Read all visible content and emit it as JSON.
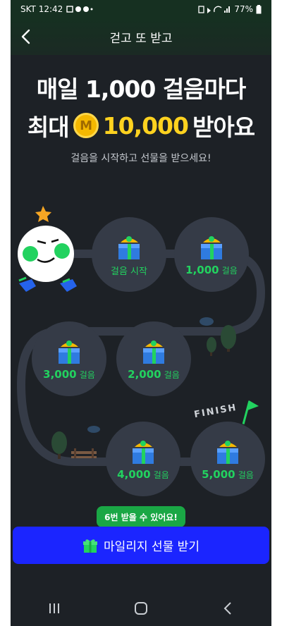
{
  "status": {
    "carrier_time": "SKT 12:42",
    "battery": "77%"
  },
  "header": {
    "title": "걷고 또 받고"
  },
  "hero": {
    "line1": "매일 1,000 걸음마다",
    "line2_prefix": "최대",
    "coin_letter": "M",
    "line2_amount": "10,000",
    "line2_suffix": "받아요"
  },
  "subtitle": "걸음을 시작하고 선물을 받으세요!",
  "milestones": [
    {
      "label": "걸음 시작"
    },
    {
      "num": "1,000",
      "unit": "걸음"
    },
    {
      "num": "2,000",
      "unit": "걸음"
    },
    {
      "num": "3,000",
      "unit": "걸음"
    },
    {
      "num": "4,000",
      "unit": "걸음"
    },
    {
      "num": "5,000",
      "unit": "걸음"
    }
  ],
  "finish_label": "FINISH",
  "tooltip": "6번 받을 수 있어요!",
  "cta": {
    "label": "마일리지 선물 받기"
  },
  "colors": {
    "accent_green": "#22d25f",
    "cta_blue": "#1b25ff",
    "highlight_yellow": "#ffd21f"
  }
}
